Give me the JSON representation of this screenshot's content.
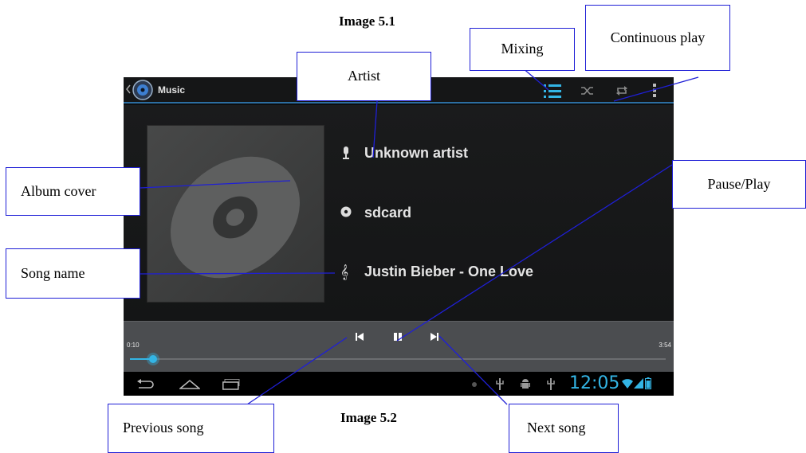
{
  "captions": {
    "top": "Image 5.1",
    "bottom": "Image 5.2"
  },
  "app": {
    "title": "Music"
  },
  "track": {
    "artist": "Unknown artist",
    "album": "sdcard",
    "song": "Justin Bieber - One Love",
    "elapsed": "0:10",
    "duration": "3:54",
    "progress_fraction": 0.043
  },
  "status_bar": {
    "time": "12:05"
  },
  "icons": {
    "back": "chevron-left-icon",
    "app_icon": "music-disc-icon",
    "playlist": "playlist-icon",
    "shuffle": "shuffle-icon",
    "repeat": "repeat-icon",
    "overflow": "overflow-menu-icon",
    "artist": "microphone-icon",
    "album": "disc-icon",
    "song": "treble-clef-icon",
    "previous": "previous-icon",
    "pause": "pause-icon",
    "next": "next-icon",
    "nav_back": "nav-back-icon",
    "nav_home": "nav-home-icon",
    "nav_recents": "nav-recents-icon"
  },
  "colors": {
    "accent": "#33b5e5",
    "callout_border": "#1f1fd6",
    "clock": "#33b5e5"
  },
  "callouts": {
    "artist": "Artist",
    "mixing": "Mixing",
    "continuous_play": "Continuous play",
    "album_cover": "Album cover",
    "pause_play": "Pause/Play",
    "song_name": "Song name",
    "previous_song": "Previous song",
    "next_song": "Next song"
  }
}
